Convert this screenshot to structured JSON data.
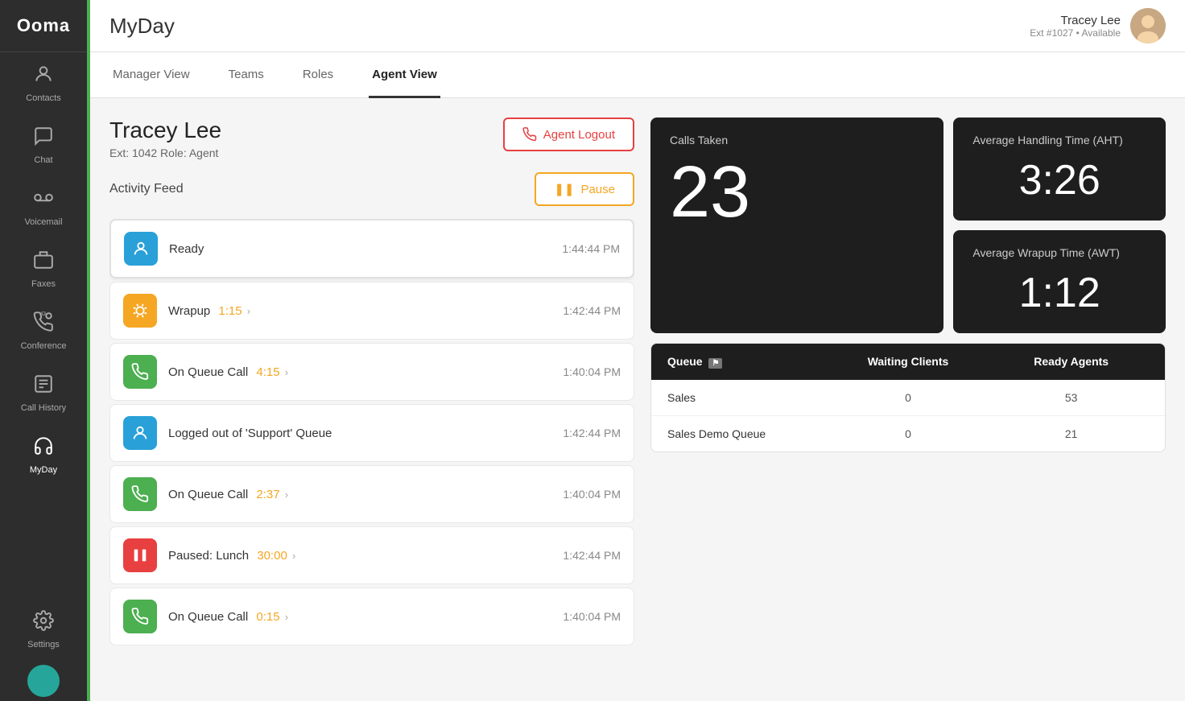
{
  "app": {
    "logo": "Ooma"
  },
  "sidebar": {
    "items": [
      {
        "id": "contacts",
        "label": "Contacts",
        "icon": "👤"
      },
      {
        "id": "chat",
        "label": "Chat",
        "icon": "💬"
      },
      {
        "id": "voicemail",
        "label": "Voicemail",
        "icon": "📻"
      },
      {
        "id": "faxes",
        "label": "Faxes",
        "icon": "⌨"
      },
      {
        "id": "conference",
        "label": "Conference",
        "icon": "📞"
      },
      {
        "id": "callhistory",
        "label": "Call History",
        "icon": "📋"
      },
      {
        "id": "myday",
        "label": "MyDay",
        "icon": "🎧"
      },
      {
        "id": "settings",
        "label": "Settings",
        "icon": "⚙"
      }
    ]
  },
  "header": {
    "title": "MyDay",
    "user": {
      "name": "Tracey Lee",
      "ext": "Ext #1027",
      "status": "Available"
    }
  },
  "tabs": [
    {
      "id": "manager",
      "label": "Manager View",
      "active": false
    },
    {
      "id": "teams",
      "label": "Teams",
      "active": false
    },
    {
      "id": "roles",
      "label": "Roles",
      "active": false
    },
    {
      "id": "agentview",
      "label": "Agent View",
      "active": true
    }
  ],
  "agent": {
    "name": "Tracey Lee",
    "ext_role": "Ext: 1042 Role: Agent",
    "logout_btn": "Agent Logout",
    "activity_label": "Activity Feed",
    "pause_btn": "Pause"
  },
  "feed": [
    {
      "status": "Ready",
      "time": "1:44:44 PM",
      "icon_type": "blue",
      "icon": "person",
      "timer": "",
      "arrow": false
    },
    {
      "status": "Wrapup",
      "time": "1:42:44 PM",
      "icon_type": "orange",
      "icon": "beach",
      "timer": "1:15",
      "arrow": true
    },
    {
      "status": "On Queue Call",
      "time": "1:40:04 PM",
      "icon_type": "green",
      "icon": "phone",
      "timer": "4:15",
      "arrow": true
    },
    {
      "status": "Logged out of 'Support' Queue",
      "time": "1:42:44 PM",
      "icon_type": "blue",
      "icon": "person",
      "timer": "",
      "arrow": false
    },
    {
      "status": "On Queue Call",
      "time": "1:40:04 PM",
      "icon_type": "green",
      "icon": "phone",
      "timer": "2:37",
      "arrow": true
    },
    {
      "status": "Paused: Lunch",
      "time": "1:42:44 PM",
      "icon_type": "red",
      "icon": "pause",
      "timer": "30:00",
      "arrow": true
    },
    {
      "status": "On Queue Call",
      "time": "1:40:04 PM",
      "icon_type": "green",
      "icon": "phone",
      "timer": "0:15",
      "arrow": true
    }
  ],
  "stats": {
    "calls_taken_label": "Calls Taken",
    "calls_taken_value": "23",
    "aht_label": "Average Handling Time (AHT)",
    "aht_value": "3:26",
    "awt_label": "Average Wrapup Time (AWT)",
    "awt_value": "1:12"
  },
  "queue": {
    "headers": [
      "Queue",
      "Waiting Clients",
      "Ready Agents"
    ],
    "rows": [
      {
        "name": "Sales",
        "waiting": "0",
        "ready": "53"
      },
      {
        "name": "Sales Demo Queue",
        "waiting": "0",
        "ready": "21"
      }
    ]
  }
}
